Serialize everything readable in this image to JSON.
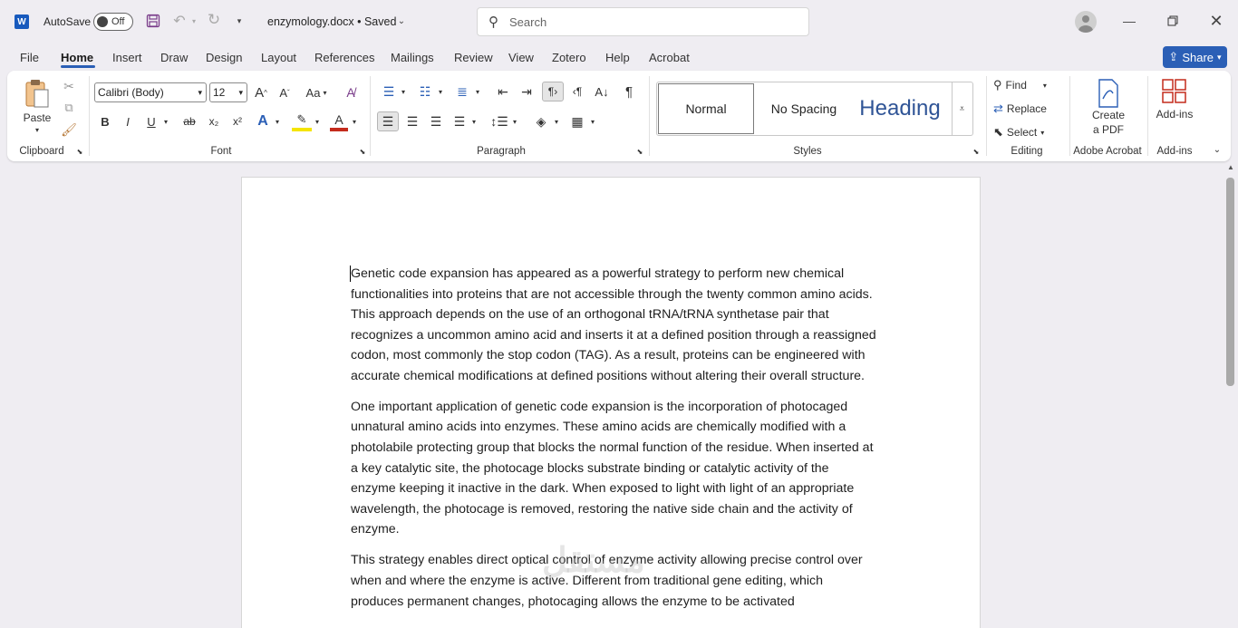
{
  "app": {
    "name": "Word"
  },
  "title_bar": {
    "autosave_label": "AutoSave",
    "autosave_state": "Off",
    "doc_title": "enzymology.docx • Saved",
    "search_placeholder": "Search"
  },
  "menu": {
    "items": [
      "File",
      "Home",
      "Insert",
      "Draw",
      "Design",
      "Layout",
      "References",
      "Mailings",
      "Review",
      "View",
      "Zotero",
      "Help",
      "Acrobat"
    ],
    "active": "Home",
    "share_label": "Share"
  },
  "ribbon": {
    "clipboard": {
      "label": "Clipboard",
      "paste": "Paste"
    },
    "font": {
      "label": "Font",
      "name": "Calibri (Body)",
      "size": "12",
      "case": "Aa",
      "bold": "B",
      "italic": "I",
      "underline": "U",
      "strike": "ab",
      "sub": "x₂",
      "sup": "x²"
    },
    "paragraph": {
      "label": "Paragraph"
    },
    "styles": {
      "label": "Styles",
      "items": [
        "Normal",
        "No Spacing",
        "Heading"
      ]
    },
    "editing": {
      "label": "Editing",
      "find": "Find",
      "replace": "Replace",
      "select": "Select"
    },
    "acrobat": {
      "label": "Adobe Acrobat",
      "create_line1": "Create",
      "create_line2": "a PDF"
    },
    "addins": {
      "label": "Add-ins",
      "button": "Add-ins"
    }
  },
  "document": {
    "paragraphs": [
      "Genetic code expansion has appeared as a powerful strategy to perform new chemical functionalities into proteins that are not accessible through the twenty common amino acids. This approach depends on the use of an orthogonal tRNA/tRNA synthetase pair that recognizes a uncommon amino acid and inserts it at a defined position through a reassigned codon, most commonly the stop codon (TAG). As a result, proteins can be engineered with accurate chemical modifications at defined positions without altering their overall structure.",
      "One important application of genetic code expansion is the incorporation of photocaged unnatural amino acids into enzymes. These amino acids are chemically modified with a photolabile protecting group that blocks the normal function of the residue. When inserted at a key catalytic site, the photocage blocks substrate binding or catalytic activity of the enzyme keeping it inactive in the dark. When exposed to light with light of an appropriate wavelength, the photocage is removed, restoring the native side chain and the activity of enzyme.",
      "This strategy enables direct optical control of enzyme activity allowing precise control over when and where the enzyme is active. Different from traditional gene editing, which produces permanent changes, photocaging allows the enzyme to be activated"
    ],
    "watermark": "مستقل"
  },
  "colors": {
    "accent": "#2b5fb6",
    "word_blue": "#185abd"
  }
}
